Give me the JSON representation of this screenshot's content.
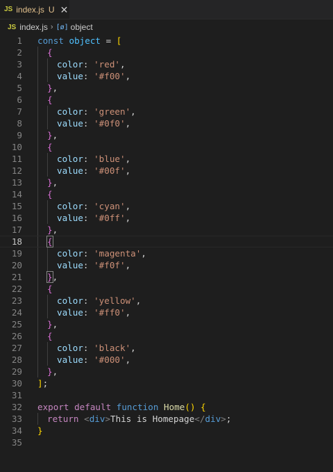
{
  "tab": {
    "icon": "JS",
    "filename": "index.js",
    "status": "U",
    "close": "✕"
  },
  "breadcrumb": {
    "icon": "JS",
    "file": "index.js",
    "separator": "›",
    "symbol_icon": "[ø]",
    "symbol": "object"
  },
  "colors": {
    "background": "#1e1e1e",
    "keyword": "#569cd6",
    "string": "#ce9178",
    "property": "#9cdcfe",
    "function": "#dcdcaa"
  },
  "code": {
    "current_line": 18,
    "lines": [
      {
        "n": "1",
        "indent": 0,
        "tokens": [
          [
            "kw",
            "const"
          ],
          [
            "p",
            " "
          ],
          [
            "var",
            "object"
          ],
          [
            "p",
            " = "
          ],
          [
            "b1",
            "["
          ]
        ]
      },
      {
        "n": "2",
        "indent": 1,
        "tokens": [
          [
            "b2",
            "{"
          ]
        ]
      },
      {
        "n": "3",
        "indent": 2,
        "tokens": [
          [
            "prop",
            "color"
          ],
          [
            "p",
            ": "
          ],
          [
            "str",
            "'red'"
          ],
          [
            "p",
            ","
          ]
        ]
      },
      {
        "n": "4",
        "indent": 2,
        "tokens": [
          [
            "prop",
            "value"
          ],
          [
            "p",
            ": "
          ],
          [
            "str",
            "'#f00'"
          ],
          [
            "p",
            ","
          ]
        ]
      },
      {
        "n": "5",
        "indent": 1,
        "tokens": [
          [
            "b2",
            "}"
          ],
          [
            "p",
            ","
          ]
        ]
      },
      {
        "n": "6",
        "indent": 1,
        "tokens": [
          [
            "b2",
            "{"
          ]
        ]
      },
      {
        "n": "7",
        "indent": 2,
        "tokens": [
          [
            "prop",
            "color"
          ],
          [
            "p",
            ": "
          ],
          [
            "str",
            "'green'"
          ],
          [
            "p",
            ","
          ]
        ]
      },
      {
        "n": "8",
        "indent": 2,
        "tokens": [
          [
            "prop",
            "value"
          ],
          [
            "p",
            ": "
          ],
          [
            "str",
            "'#0f0'"
          ],
          [
            "p",
            ","
          ]
        ]
      },
      {
        "n": "9",
        "indent": 1,
        "tokens": [
          [
            "b2",
            "}"
          ],
          [
            "p",
            ","
          ]
        ]
      },
      {
        "n": "10",
        "indent": 1,
        "tokens": [
          [
            "b2",
            "{"
          ]
        ]
      },
      {
        "n": "11",
        "indent": 2,
        "tokens": [
          [
            "prop",
            "color"
          ],
          [
            "p",
            ": "
          ],
          [
            "str",
            "'blue'"
          ],
          [
            "p",
            ","
          ]
        ]
      },
      {
        "n": "12",
        "indent": 2,
        "tokens": [
          [
            "prop",
            "value"
          ],
          [
            "p",
            ": "
          ],
          [
            "str",
            "'#00f'"
          ],
          [
            "p",
            ","
          ]
        ]
      },
      {
        "n": "13",
        "indent": 1,
        "tokens": [
          [
            "b2",
            "}"
          ],
          [
            "p",
            ","
          ]
        ]
      },
      {
        "n": "14",
        "indent": 1,
        "tokens": [
          [
            "b2",
            "{"
          ]
        ]
      },
      {
        "n": "15",
        "indent": 2,
        "tokens": [
          [
            "prop",
            "color"
          ],
          [
            "p",
            ": "
          ],
          [
            "str",
            "'cyan'"
          ],
          [
            "p",
            ","
          ]
        ]
      },
      {
        "n": "16",
        "indent": 2,
        "tokens": [
          [
            "prop",
            "value"
          ],
          [
            "p",
            ": "
          ],
          [
            "str",
            "'#0ff'"
          ],
          [
            "p",
            ","
          ]
        ]
      },
      {
        "n": "17",
        "indent": 1,
        "tokens": [
          [
            "b2",
            "}"
          ],
          [
            "p",
            ","
          ]
        ]
      },
      {
        "n": "18",
        "indent": 1,
        "tokens": [
          [
            "b2m",
            "{"
          ]
        ]
      },
      {
        "n": "19",
        "indent": 2,
        "tokens": [
          [
            "prop",
            "color"
          ],
          [
            "p",
            ": "
          ],
          [
            "str",
            "'magenta'"
          ],
          [
            "p",
            ","
          ]
        ]
      },
      {
        "n": "20",
        "indent": 2,
        "tokens": [
          [
            "prop",
            "value"
          ],
          [
            "p",
            ": "
          ],
          [
            "str",
            "'#f0f'"
          ],
          [
            "p",
            ","
          ]
        ]
      },
      {
        "n": "21",
        "indent": 1,
        "tokens": [
          [
            "b2m",
            "}"
          ],
          [
            "p",
            ","
          ]
        ]
      },
      {
        "n": "22",
        "indent": 1,
        "tokens": [
          [
            "b2",
            "{"
          ]
        ]
      },
      {
        "n": "23",
        "indent": 2,
        "tokens": [
          [
            "prop",
            "color"
          ],
          [
            "p",
            ": "
          ],
          [
            "str",
            "'yellow'"
          ],
          [
            "p",
            ","
          ]
        ]
      },
      {
        "n": "24",
        "indent": 2,
        "tokens": [
          [
            "prop",
            "value"
          ],
          [
            "p",
            ": "
          ],
          [
            "str",
            "'#ff0'"
          ],
          [
            "p",
            ","
          ]
        ]
      },
      {
        "n": "25",
        "indent": 1,
        "tokens": [
          [
            "b2",
            "}"
          ],
          [
            "p",
            ","
          ]
        ]
      },
      {
        "n": "26",
        "indent": 1,
        "tokens": [
          [
            "b2",
            "{"
          ]
        ]
      },
      {
        "n": "27",
        "indent": 2,
        "tokens": [
          [
            "prop",
            "color"
          ],
          [
            "p",
            ": "
          ],
          [
            "str",
            "'black'"
          ],
          [
            "p",
            ","
          ]
        ]
      },
      {
        "n": "28",
        "indent": 2,
        "tokens": [
          [
            "prop",
            "value"
          ],
          [
            "p",
            ": "
          ],
          [
            "str",
            "'#000'"
          ],
          [
            "p",
            ","
          ]
        ]
      },
      {
        "n": "29",
        "indent": 1,
        "tokens": [
          [
            "b2",
            "}"
          ],
          [
            "p",
            ","
          ]
        ]
      },
      {
        "n": "30",
        "indent": 0,
        "tokens": [
          [
            "b1",
            "]"
          ],
          [
            "p",
            ";"
          ]
        ]
      },
      {
        "n": "31",
        "indent": 0,
        "tokens": []
      },
      {
        "n": "32",
        "indent": 0,
        "tokens": [
          [
            "kw2",
            "export"
          ],
          [
            "p",
            " "
          ],
          [
            "kw2",
            "default"
          ],
          [
            "p",
            " "
          ],
          [
            "kw",
            "function"
          ],
          [
            "p",
            " "
          ],
          [
            "fn",
            "Home"
          ],
          [
            "b1",
            "()"
          ],
          [
            "p",
            " "
          ],
          [
            "b1",
            "{"
          ]
        ]
      },
      {
        "n": "33",
        "indent": 1,
        "tokens": [
          [
            "kw2",
            "return"
          ],
          [
            "p",
            " "
          ],
          [
            "tagb",
            "<"
          ],
          [
            "tag",
            "div"
          ],
          [
            "tagb",
            ">"
          ],
          [
            "p",
            "This is Homepage"
          ],
          [
            "tagb",
            "</"
          ],
          [
            "tag",
            "div"
          ],
          [
            "tagb",
            ">"
          ],
          [
            "p",
            ";"
          ]
        ]
      },
      {
        "n": "34",
        "indent": 0,
        "tokens": [
          [
            "b1",
            "}"
          ]
        ]
      },
      {
        "n": "35",
        "indent": 0,
        "tokens": []
      }
    ]
  }
}
